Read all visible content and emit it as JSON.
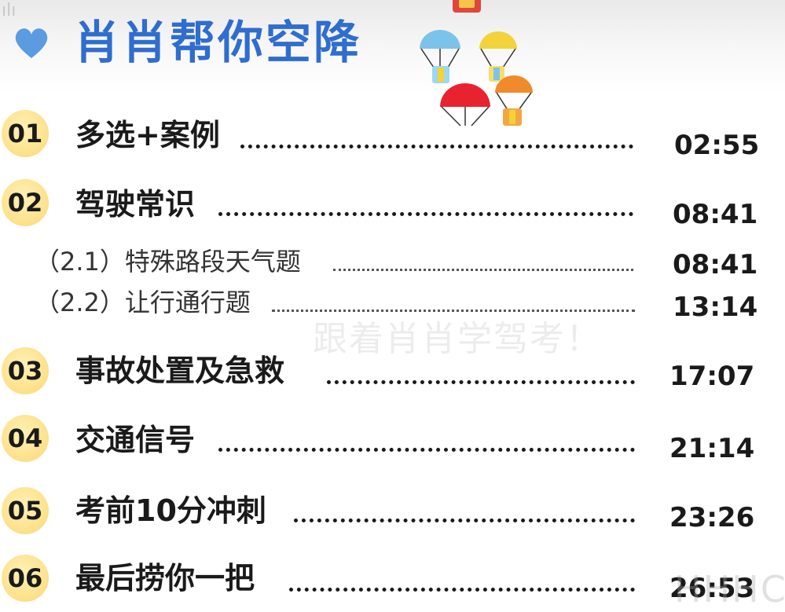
{
  "header": {
    "title": "肖肖帮你空降",
    "corner_mark": "ılı",
    "heart_color": "#5b9be0",
    "title_color": "#2f6dce"
  },
  "decoration": {
    "parachute_colors": [
      "#7cc3ea",
      "#f4d23a",
      "#e8232f",
      "#f08a2a",
      "#e0473a"
    ]
  },
  "menu": {
    "items": [
      {
        "number": "01",
        "label": "多选+案例",
        "time": "02:55"
      },
      {
        "number": "02",
        "label": "驾驶常识",
        "time": "08:41"
      },
      {
        "number": "03",
        "label": "事故处置及急救",
        "time": "17:07"
      },
      {
        "number": "04",
        "label": "交通信号",
        "time": "21:14"
      },
      {
        "number": "05",
        "label": "考前10分冲刺",
        "time": "23:26"
      },
      {
        "number": "06",
        "label": "最后捞你一把",
        "time": "26:53"
      }
    ],
    "subitems": [
      {
        "label": "（2.1）特殊路段天气题",
        "time": "08:41"
      },
      {
        "label": "（2.2）让行通行题",
        "time": "13:14"
      }
    ]
  },
  "watermark": {
    "text": "跟着肖肖学驾考！",
    "corner_text": "HHHC"
  },
  "colors": {
    "badge": "#fde38f",
    "text": "#1a1a1a"
  }
}
